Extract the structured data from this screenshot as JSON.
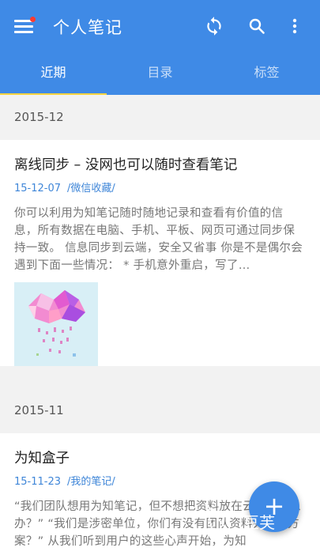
{
  "app": {
    "title": "个人笔记"
  },
  "toolbar": {
    "icons": [
      "menu-icon",
      "sync-icon",
      "search-icon",
      "more-vert-icon"
    ]
  },
  "tabs": [
    {
      "label": "近期",
      "active": true
    },
    {
      "label": "目录",
      "active": false
    },
    {
      "label": "标签",
      "active": false
    }
  ],
  "sections": [
    {
      "month": "2015-12",
      "note": {
        "title": "离线同步 – 没网也可以随时查看笔记",
        "date": "15-12-07",
        "folder": "/微信收藏/",
        "excerpt": "你可以利用为知笔记随时随地记录和查看有价值的信息，所有数据在电脑、手机、平板、网页可通过同步保持一致。 信息同步到云端，安全又省事 你是不是偶尔会遇到下面一些情况： * 手机意外重启，写了…",
        "thumbnail": "rain-cloud-image"
      }
    },
    {
      "month": "2015-11",
      "note": {
        "title": "为知盒子",
        "date": "15-11-23",
        "folder": "/我的笔记/",
        "excerpt": "“我们团队想用为知笔记，但不想把资料放在云端，怎么办？” “我们是涉密单位，你们有没有团队资料共享的方案？” 从我们听到用户的这些心声开始，为知"
      }
    }
  ],
  "fab": {
    "label": "+"
  },
  "watermark": "豆芙",
  "colors": {
    "primary": "#3f8ae6",
    "accent": "#f6d33f",
    "link": "#3f86d8"
  }
}
